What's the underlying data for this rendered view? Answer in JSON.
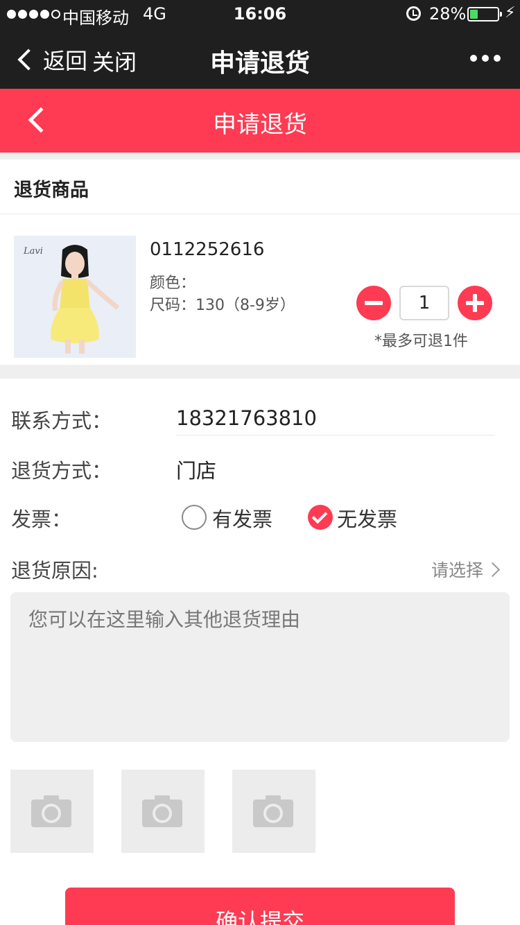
{
  "status_bar": {
    "carrier": "中国移动",
    "network": "4G",
    "time": "16:06",
    "battery_percent": "28%",
    "battery_level": 0.28,
    "signal_bars_filled": 4,
    "signal_bars_total": 5
  },
  "nav": {
    "back_label": "返回",
    "close_label": "关闭",
    "title": "申请退货"
  },
  "header": {
    "title": "申请退货",
    "color": "#fe3b52"
  },
  "return_goods": {
    "section_title": "退货商品",
    "product": {
      "sku": "0112252616",
      "color_label": "颜色：",
      "size_label": "尺码：130（8-9岁）"
    },
    "quantity": "1",
    "max_note": "*最多可退1件"
  },
  "form": {
    "contact_label": "联系方式：",
    "contact_value": "18321763810",
    "method_label": "退货方式：",
    "method_value": "门店",
    "invoice_label": "发票：",
    "invoice_options": [
      {
        "label": "有发票",
        "selected": false
      },
      {
        "label": "无发票",
        "selected": true
      }
    ],
    "reason_label": "退货原因:",
    "reason_select": "请选择",
    "reason_placeholder": "您可以在这里输入其他退货理由"
  },
  "photos": {
    "slots": [
      "camera-icon",
      "camera-icon",
      "camera-icon"
    ]
  },
  "submit_label": "确认提交"
}
